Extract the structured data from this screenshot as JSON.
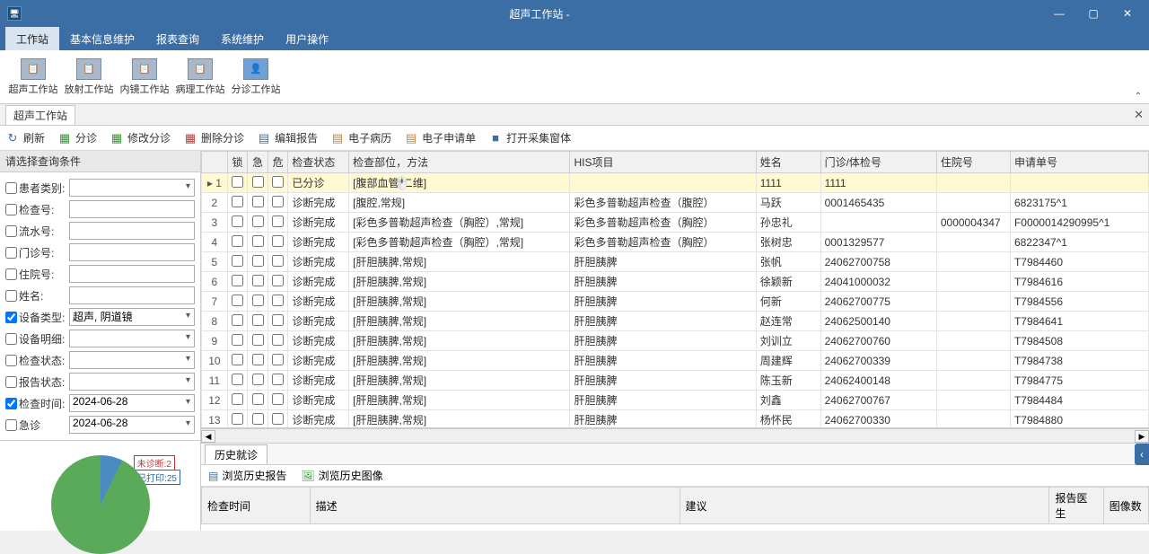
{
  "window": {
    "title": "超声工作站 -"
  },
  "menubar": [
    "工作站",
    "基本信息维护",
    "报表查询",
    "系统维护",
    "用户操作"
  ],
  "ribbon": [
    {
      "label": "超声工作站"
    },
    {
      "label": "放射工作站"
    },
    {
      "label": "内镜工作站"
    },
    {
      "label": "病理工作站"
    },
    {
      "label": "分诊工作站"
    }
  ],
  "subtab": "超声工作站",
  "toolbar": [
    {
      "label": "刷新",
      "icon": "↻",
      "cls": "ic-refresh"
    },
    {
      "label": "分诊",
      "icon": "▦",
      "cls": "ic-green"
    },
    {
      "label": "修改分诊",
      "icon": "▦",
      "cls": "ic-green"
    },
    {
      "label": "删除分诊",
      "icon": "▦",
      "cls": "ic-red"
    },
    {
      "label": "编辑报告",
      "icon": "▤",
      "cls": "ic-blue"
    },
    {
      "label": "电子病历",
      "icon": "▤",
      "cls": "ic-orange"
    },
    {
      "label": "电子申请单",
      "icon": "▤",
      "cls": "ic-orange"
    },
    {
      "label": "打开采集窗体",
      "icon": "■",
      "cls": "ic-blue"
    }
  ],
  "side_head": "请选择查询条件",
  "fields": [
    {
      "label": "患者类别:",
      "checked": false,
      "combo": true,
      "value": ""
    },
    {
      "label": "检查号:",
      "checked": false,
      "value": ""
    },
    {
      "label": "流水号:",
      "checked": false,
      "value": ""
    },
    {
      "label": "门诊号:",
      "checked": false,
      "value": ""
    },
    {
      "label": "住院号:",
      "checked": false,
      "value": ""
    },
    {
      "label": "姓名:",
      "checked": false,
      "value": ""
    },
    {
      "label": "设备类型:",
      "checked": true,
      "combo": true,
      "value": "超声, 阴道镜"
    },
    {
      "label": "设备明细:",
      "checked": false,
      "combo": true,
      "value": ""
    },
    {
      "label": "检查状态:",
      "checked": false,
      "combo": true,
      "value": ""
    },
    {
      "label": "报告状态:",
      "checked": false,
      "combo": true,
      "value": ""
    },
    {
      "label": "检查时间:",
      "checked": true,
      "combo": true,
      "value": "2024-06-28"
    },
    {
      "label": "急诊",
      "checked": false,
      "combo": true,
      "value": "2024-06-28"
    }
  ],
  "columns": [
    "",
    "锁",
    "急",
    "危",
    "检查状态",
    "检查部位，方法",
    "HIS项目",
    "姓名",
    "门诊/体检号",
    "住院号",
    "申请单号"
  ],
  "rows": [
    {
      "n": 1,
      "sel": true,
      "status": "已分诊",
      "site": "[腹部血管,二维]",
      "his": "",
      "name": "1111",
      "op": "1111",
      "ip": "",
      "req": ""
    },
    {
      "n": 2,
      "status": "诊断完成",
      "site": "[腹腔,常规]",
      "his": "彩色多普勒超声检查（腹腔）",
      "name": "马跃",
      "op": "0001465435",
      "ip": "",
      "req": "6823175^1"
    },
    {
      "n": 3,
      "status": "诊断完成",
      "site": "[彩色多普勒超声检查（胸腔）,常规]",
      "his": "彩色多普勒超声检查（胸腔）",
      "name": "孙忠礼",
      "op": "",
      "ip": "0000004347",
      "req": "F0000014290995^1"
    },
    {
      "n": 4,
      "status": "诊断完成",
      "site": "[彩色多普勒超声检查（胸腔）,常规]",
      "his": "彩色多普勒超声检查（胸腔）",
      "name": "张树忠",
      "op": "0001329577",
      "ip": "",
      "req": "6822347^1"
    },
    {
      "n": 5,
      "status": "诊断完成",
      "site": "[肝胆胰脾,常规]",
      "his": "肝胆胰脾",
      "name": "张帆",
      "op": "24062700758",
      "ip": "",
      "req": "T7984460"
    },
    {
      "n": 6,
      "status": "诊断完成",
      "site": "[肝胆胰脾,常规]",
      "his": "肝胆胰脾",
      "name": "徐颖新",
      "op": "24041000032",
      "ip": "",
      "req": "T7984616"
    },
    {
      "n": 7,
      "status": "诊断完成",
      "site": "[肝胆胰脾,常规]",
      "his": "肝胆胰脾",
      "name": "何新",
      "op": "24062700775",
      "ip": "",
      "req": "T7984556"
    },
    {
      "n": 8,
      "status": "诊断完成",
      "site": "[肝胆胰脾,常规]",
      "his": "肝胆胰脾",
      "name": "赵连常",
      "op": "24062500140",
      "ip": "",
      "req": "T7984641"
    },
    {
      "n": 9,
      "status": "诊断完成",
      "site": "[肝胆胰脾,常规]",
      "his": "肝胆胰脾",
      "name": "刘训立",
      "op": "24062700760",
      "ip": "",
      "req": "T7984508"
    },
    {
      "n": 10,
      "status": "诊断完成",
      "site": "[肝胆胰脾,常规]",
      "his": "肝胆胰脾",
      "name": "周建辉",
      "op": "24062700339",
      "ip": "",
      "req": "T7984738"
    },
    {
      "n": 11,
      "status": "诊断完成",
      "site": "[肝胆胰脾,常规]",
      "his": "肝胆胰脾",
      "name": "陈玉新",
      "op": "24062400148",
      "ip": "",
      "req": "T7984775"
    },
    {
      "n": 12,
      "status": "诊断完成",
      "site": "[肝胆胰脾,常规]",
      "his": "肝胆胰脾",
      "name": "刘鑫",
      "op": "24062700767",
      "ip": "",
      "req": "T7984484"
    },
    {
      "n": 13,
      "status": "诊断完成",
      "site": "[肝胆胰脾,常规]",
      "his": "肝胆胰脾",
      "name": "杨怀民",
      "op": "24062700330",
      "ip": "",
      "req": "T7984880"
    }
  ],
  "chart_data": {
    "type": "pie",
    "title": "",
    "series": [
      {
        "name": "未诊断",
        "value": 2
      },
      {
        "name": "已打印",
        "value": 25
      }
    ],
    "labels": {
      "a": "未诊断:2",
      "b": "已打印:25"
    }
  },
  "bottom": {
    "tab": "历史就诊",
    "toolbar": [
      "浏览历史报告",
      "浏览历史图像"
    ],
    "columns": [
      "检查时间",
      "描述",
      "建议",
      "报告医生",
      "图像数"
    ]
  }
}
